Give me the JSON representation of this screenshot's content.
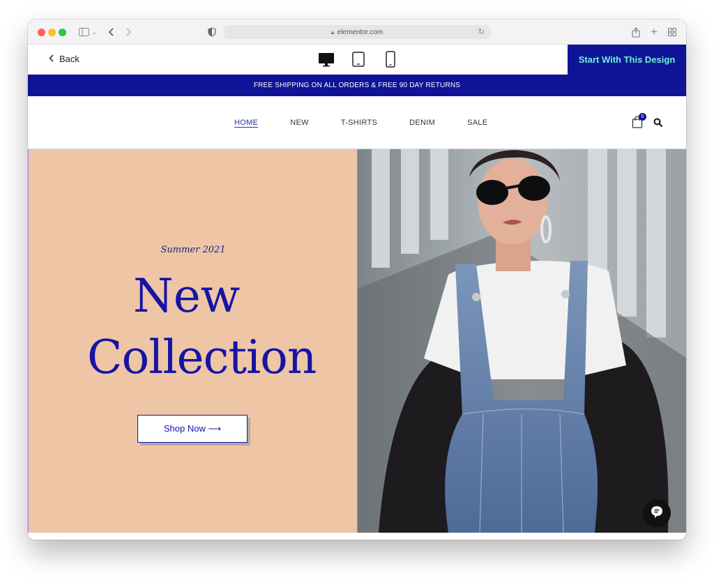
{
  "browser": {
    "url": "elementor.com",
    "icons": [
      "sidebar-icon",
      "chevron-down-icon",
      "back-arrow-icon",
      "forward-arrow-icon",
      "shield-icon",
      "lock-icon",
      "reload-icon",
      "share-icon",
      "new-tab-icon",
      "tab-grid-icon"
    ]
  },
  "toolbar": {
    "back_label": "Back",
    "start_label": "Start With This Design",
    "devices": [
      "desktop-icon",
      "tablet-icon",
      "mobile-icon"
    ]
  },
  "site": {
    "promo": "FREE SHIPPING ON ALL ORDERS & FREE 90 DAY RETURNS",
    "nav": [
      "HOME",
      "NEW",
      "T-SHIRTS",
      "DENIM",
      "SALE"
    ],
    "cart_count": "0",
    "hero": {
      "eyebrow": "Summer 2021",
      "title_line1": "New",
      "title_line2": "Collection",
      "cta": "Shop Now ⟶"
    }
  },
  "colors": {
    "brand_blue": "#0f1497",
    "accent_mint": "#6ef3d4",
    "hero_peach": "#eec6a6"
  }
}
